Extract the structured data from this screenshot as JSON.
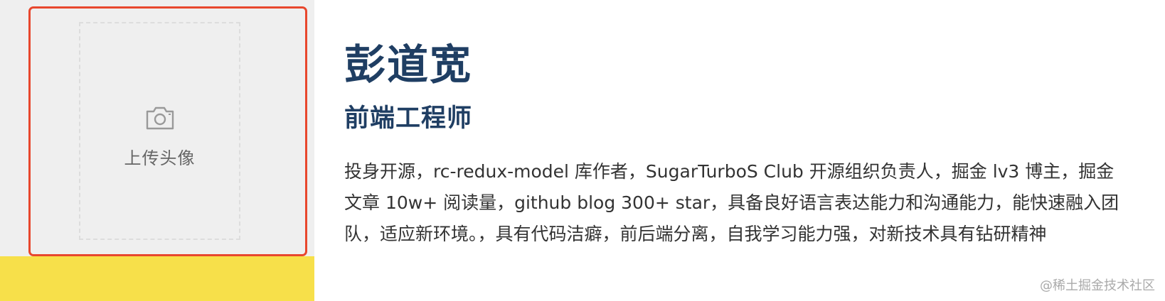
{
  "avatar_upload": {
    "icon": "camera-icon",
    "label": "上传头像",
    "border_color": "#e8472d"
  },
  "profile": {
    "name": "彭道宽",
    "role": "前端工程师",
    "intro": "投身开源，rc-redux-model 库作者，SugarTurboS Club 开源组织负责人，掘金 lv3 博主，掘金文章 10w+ 阅读量，github blog 300+ star，具备良好语言表达能力和沟通能力，能快速融入团队，适应新环境。，具有代码洁癖，前后端分离，自我学习能力强，对新技术具有钻研精神",
    "heading_color": "#1f3e63"
  },
  "watermark": "@稀土掘金技术社区",
  "colors": {
    "left_panel": "#efefef",
    "accent_yellow": "#f7e04a"
  }
}
